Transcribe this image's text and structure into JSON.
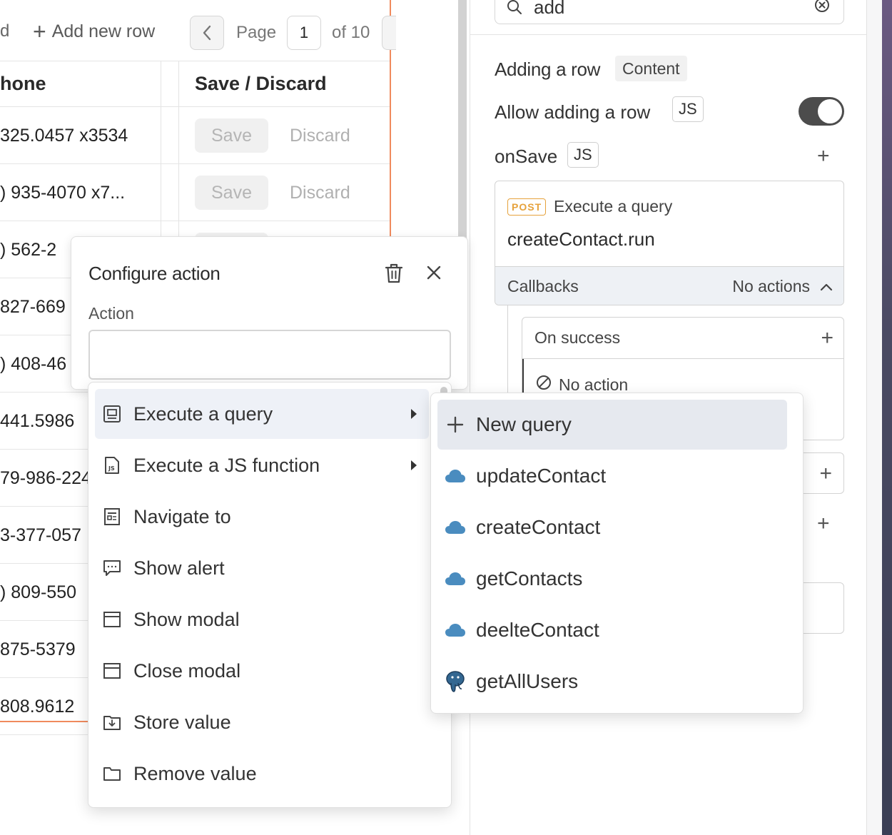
{
  "table": {
    "toolbar": {
      "cut_text": "d",
      "add_row_label": "Add new row",
      "page_label": "Page",
      "page_value": "1",
      "of_label": "of 10"
    },
    "headers": {
      "phone": "hone",
      "save_discard": "Save / Discard"
    },
    "rows": [
      {
        "phone": "325.0457 x3534"
      },
      {
        "phone": ") 935-4070 x7..."
      },
      {
        "phone": ") 562-2"
      },
      {
        "phone": "827-669"
      },
      {
        "phone": ") 408-46"
      },
      {
        "phone": "441.5986"
      },
      {
        "phone": "79-986-224"
      },
      {
        "phone": "3-377-057"
      },
      {
        "phone": ") 809-550"
      },
      {
        "phone": "875-5379"
      },
      {
        "phone": "808.9612"
      }
    ],
    "save_label": "Save",
    "discard_label": "Discard"
  },
  "panel": {
    "search": {
      "value": "add"
    },
    "section_title": "Adding a row",
    "section_badge": "Content",
    "allow_label": "Allow adding a row",
    "allow_enabled": true,
    "js_label": "JS",
    "onsave_label": "onSave",
    "card": {
      "method": "POST",
      "type": "Execute a query",
      "run": "createContact.run",
      "callbacks_label": "Callbacks",
      "callbacks_status": "No actions"
    },
    "on_success_label": "On success",
    "no_action_label": "No action"
  },
  "configure": {
    "title": "Configure action",
    "action_label": "Action"
  },
  "action_menu": {
    "items": [
      {
        "label": "Execute a query",
        "icon": "query-icon",
        "submenu": true
      },
      {
        "label": "Execute a JS function",
        "icon": "js-file-icon",
        "submenu": true
      },
      {
        "label": "Navigate to",
        "icon": "navigate-icon",
        "submenu": false
      },
      {
        "label": "Show alert",
        "icon": "alert-icon",
        "submenu": false
      },
      {
        "label": "Show modal",
        "icon": "modal-icon",
        "submenu": false
      },
      {
        "label": "Close modal",
        "icon": "modal-icon",
        "submenu": false
      },
      {
        "label": "Store value",
        "icon": "store-icon",
        "submenu": false
      },
      {
        "label": "Remove value",
        "icon": "folder-icon",
        "submenu": false
      }
    ]
  },
  "query_menu": {
    "items": [
      {
        "label": "New query",
        "icon": "plus-icon"
      },
      {
        "label": "updateContact",
        "icon": "cloud-icon"
      },
      {
        "label": "createContact",
        "icon": "cloud-icon"
      },
      {
        "label": "getContacts",
        "icon": "cloud-icon"
      },
      {
        "label": "deelteContact",
        "icon": "cloud-icon"
      },
      {
        "label": "getAllUsers",
        "icon": "postgres-icon"
      }
    ]
  },
  "colors": {
    "accent_border": "#f08a5d",
    "post_badge": "#e6a23c",
    "cloud_icon": "#4a8cbf",
    "toggle_on": "#4c4c4c"
  }
}
